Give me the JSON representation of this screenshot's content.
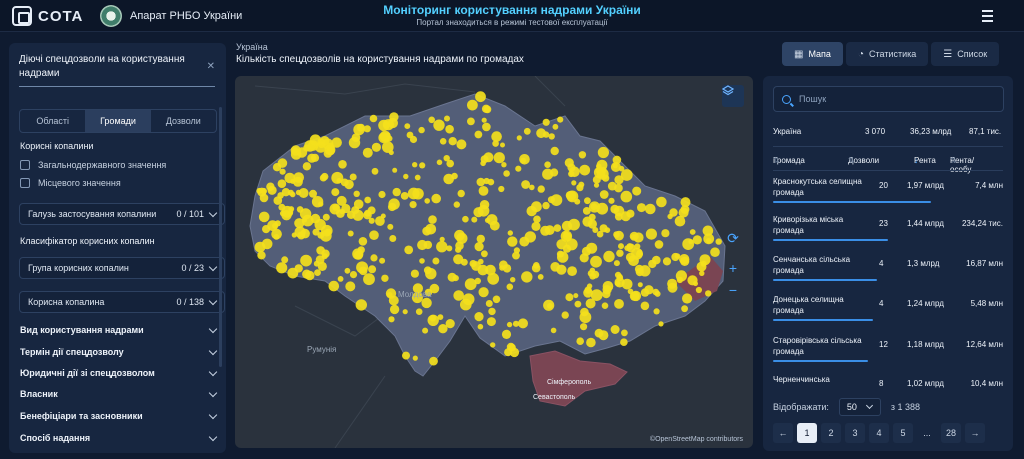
{
  "header": {
    "logo": "COTA",
    "org": "Апарат РНБО України",
    "title": "Моніторинг користування надрами України",
    "subtitle": "Портал знаходиться в режимі тестової експлуатації"
  },
  "left": {
    "search_value": "Діючі спецдозволи на користування надрами",
    "tabs": [
      "Області",
      "Громади",
      "Дозволи"
    ],
    "minerals_label": "Корисні копалини",
    "checks": [
      "Загальнодержавного значення",
      "Місцевого значення"
    ],
    "app_field": {
      "label": "Галузь застосування копалини",
      "count": "0 / 101"
    },
    "classifier_label": "Класифікатор корисних копалин",
    "group_field": {
      "label": "Група корисних копалин",
      "count": "0 / 23"
    },
    "mineral_field": {
      "label": "Корисна копалина",
      "count": "0 / 138"
    },
    "accordions": [
      "Вид користування надрами",
      "Термін дії спецдозволу",
      "Юридичні дії зі спецдозволом",
      "Власник",
      "Бенефіціари та засновники",
      "Спосіб надання"
    ]
  },
  "center": {
    "breadcrumb": "Україна",
    "title": "Кількість спецдозволів на користування надрами по громадах",
    "labels": {
      "moldova": "Молдова",
      "romania": "Румунія",
      "simferopol": "Сімферополь",
      "sevastopol": "Севастополь"
    },
    "attribution": "©OpenStreetMap contributors"
  },
  "views": [
    {
      "icon": "map-icon",
      "label": "Мапа"
    },
    {
      "icon": "stats-icon",
      "label": "Статистика"
    },
    {
      "icon": "list-icon",
      "label": "Список"
    }
  ],
  "right": {
    "search_placeholder": "Пошук",
    "summary": {
      "name": "Україна",
      "permits": "3 070",
      "rent": "36,23 млрд",
      "rent_pp": "87,1 тис."
    },
    "columns": [
      "Громада",
      "Дозволи",
      "Рента",
      "Рента/особу"
    ],
    "rows": [
      {
        "name": "Краснокутська селищна громада",
        "permits": "20",
        "rent": "1,97 млрд",
        "rent_pp": "7,4 млн",
        "share": 1.0
      },
      {
        "name": "Криворізька міська громада",
        "permits": "23",
        "rent": "1,44 млрд",
        "rent_pp": "234,24 тис.",
        "share": 0.73
      },
      {
        "name": "Сенчанська сільська громада",
        "permits": "4",
        "rent": "1,3 млрд",
        "rent_pp": "16,87 млн",
        "share": 0.66
      },
      {
        "name": "Донецька селищна громада",
        "permits": "4",
        "rent": "1,24 млрд",
        "rent_pp": "5,48 млн",
        "share": 0.63
      },
      {
        "name": "Старовірівська сільська громада",
        "permits": "12",
        "rent": "1,18 млрд",
        "rent_pp": "12,64 млн",
        "share": 0.6
      },
      {
        "name": "Черненчинська",
        "permits": "8",
        "rent": "1,02 млрд",
        "rent_pp": "10,4 млн",
        "share": 0.52
      }
    ],
    "show_label": "Відображати:",
    "per_page": "50",
    "total": "з 1 388",
    "pages": [
      "1",
      "2",
      "3",
      "4",
      "5",
      "...",
      "28"
    ]
  }
}
